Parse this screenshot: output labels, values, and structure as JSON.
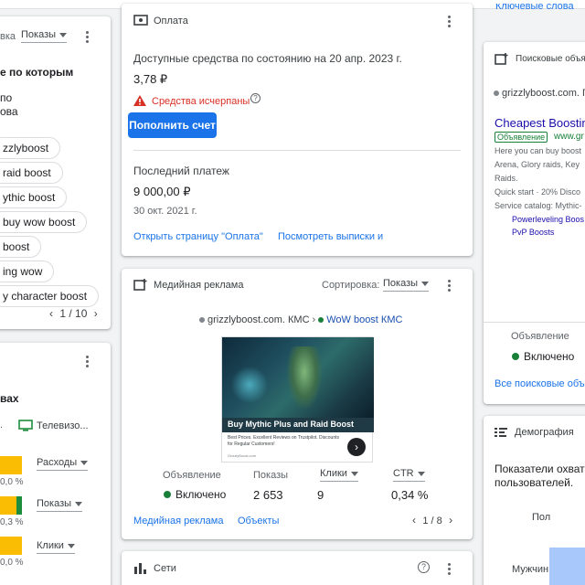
{
  "top_bar": {
    "right_link": "Ключевые слова"
  },
  "left_card1": {
    "sort_label": "вка",
    "sort_value": "Показы",
    "heading": "е по которым",
    "sub": "по",
    "sub2": "ова",
    "chips": [
      "zzlyboost",
      "raid boost",
      "ythic boost",
      "buy wow boost",
      "boost",
      "ing wow",
      "y character boost"
    ],
    "pager": "1 / 10"
  },
  "left_card2": {
    "heading": "вах",
    "tv_label": "Телевизо...",
    "metrics": [
      {
        "label": "Расходы",
        "pct": "0,0 %"
      },
      {
        "label": "Показы",
        "pct": "0,3 %"
      },
      {
        "label": "Клики",
        "pct": "0,0 %"
      }
    ],
    "bar_fill": [
      0.5,
      0.55,
      0.45
    ]
  },
  "payment": {
    "title": "Оплата",
    "available_label": "Доступные средства по состоянию на 20 апр. 2023 г.",
    "available_amount": "3,78 ₽",
    "warning": "Средства исчерпаны",
    "topup_button": "Пополнить счет",
    "last_payment_label": "Последний платеж",
    "last_payment_amount": "9 000,00 ₽",
    "last_payment_date": "30 окт. 2021 г.",
    "link_open": "Открыть страницу \"Оплата\"",
    "link_statements": "Посмотреть выписки и"
  },
  "display": {
    "title": "Медийная реклама",
    "sort_label": "Сортировка:",
    "sort_value": "Показы",
    "breadcrumb_account": "grizzlyboost.com. КМС",
    "breadcrumb_sep": "›",
    "breadcrumb_campaign": "WoW boost КМС",
    "ad_headline": "Buy Mythic Plus and Raid Boost",
    "ad_desc": "Best Prices. Excellent Reviews on Trustpilot. Discounts for Regular Customers!",
    "ad_domain": "GrizzlyBoost.com",
    "table_headers": {
      "ad": "Объявление",
      "impr": "Показы",
      "clicks": "Клики",
      "ctr": "CTR"
    },
    "row": {
      "status": "Включено",
      "impr": "2 653",
      "clicks": "9",
      "ctr": "0,34 %"
    },
    "link_display": "Медийная реклама",
    "link_objects": "Объекты",
    "pager": "1 / 8"
  },
  "networks": {
    "title": "Сети"
  },
  "search": {
    "title": "Поисковые объя",
    "account": "grizzlyboost.com. П",
    "ad_title": "Cheapest Boosting",
    "badge": "Объявление",
    "url": "www.gr",
    "line1": "Here you can buy boost",
    "line2": "Arena, Glory raids, Key",
    "line3": "Raids.",
    "line4": "Quick start · 20% Disco",
    "line5": "Service catalog: Mythic-",
    "sitelink1": "Powerleveling Boos",
    "sitelink2": "PvP Boosts",
    "col_header": "Объявление",
    "status": "Включено",
    "all_link": "Все поисковые объ"
  },
  "demography": {
    "title": "Демография",
    "text1": "Показатели охвата",
    "text2": "пользователей.",
    "gender_label": "Пол",
    "male_label": "Мужчин"
  }
}
